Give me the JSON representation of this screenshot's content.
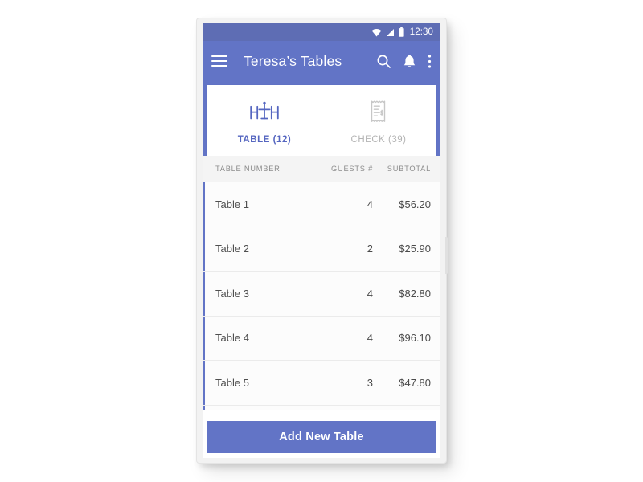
{
  "colors": {
    "status_bar": "#5e6db4",
    "app_bar": "#6274c6",
    "accent": "#6274c6",
    "tab_active": "#5566c0",
    "tab_inactive": "#b3b3b3",
    "row_bg": "#fcfcfc",
    "header_bg": "#f4f4f4"
  },
  "status_bar": {
    "clock": "12:30",
    "icons": [
      "wifi-icon",
      "signal-icon",
      "battery-icon"
    ]
  },
  "app_bar": {
    "menu_icon": "hamburger-menu-icon",
    "title": "Teresa’s Tables",
    "actions": [
      {
        "name": "search-icon",
        "label": "Search"
      },
      {
        "name": "notifications-bell-icon",
        "label": "Notifications"
      },
      {
        "name": "overflow-menu-icon",
        "label": "More options"
      }
    ]
  },
  "tabs": [
    {
      "id": "table",
      "label": "TABLE (12)",
      "count": 12,
      "icon": "table-with-chairs-icon",
      "active": true
    },
    {
      "id": "check",
      "label": "CHECK (39)",
      "count": 39,
      "icon": "receipt-icon",
      "active": false
    }
  ],
  "list": {
    "columns": [
      {
        "key": "table_number",
        "label": "TABLE NUMBER"
      },
      {
        "key": "guests",
        "label": "GUESTS #"
      },
      {
        "key": "subtotal",
        "label": "SUBTOTAL"
      }
    ],
    "rows": [
      {
        "table_number": "Table 1",
        "guests": "4",
        "subtotal": "$56.20"
      },
      {
        "table_number": "Table 2",
        "guests": "2",
        "subtotal": "$25.90"
      },
      {
        "table_number": "Table 3",
        "guests": "4",
        "subtotal": "$82.80"
      },
      {
        "table_number": "Table 4",
        "guests": "4",
        "subtotal": "$96.10"
      },
      {
        "table_number": "Table 5",
        "guests": "3",
        "subtotal": "$47.80"
      },
      {
        "table_number": "",
        "guests": "",
        "subtotal": ""
      }
    ]
  },
  "footer": {
    "add_button_label": "Add New Table"
  }
}
